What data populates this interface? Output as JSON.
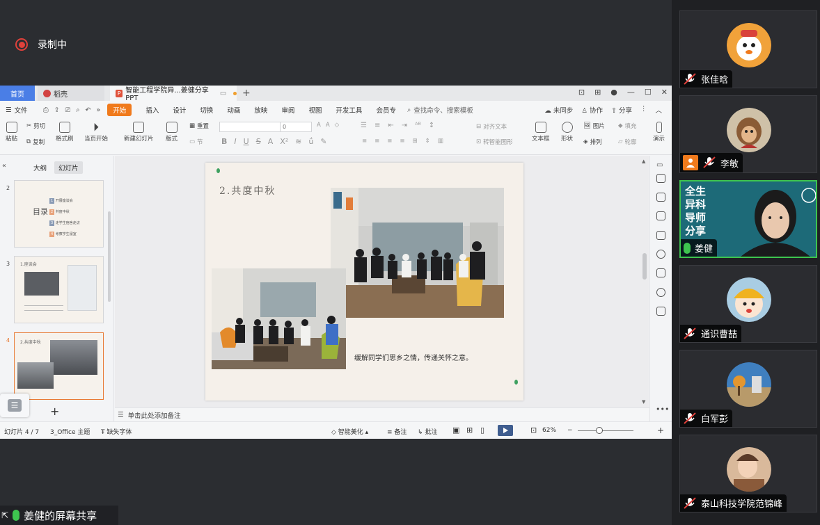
{
  "recording": {
    "label": "录制中"
  },
  "wps": {
    "tabs": {
      "home": "首页",
      "daoke": "稻壳",
      "doc": "智能工程学院异...姜健分享PPT"
    },
    "menu": {
      "file": "文件",
      "items": [
        "开始",
        "插入",
        "设计",
        "切换",
        "动画",
        "放映",
        "审阅",
        "视图",
        "开发工具",
        "会员专"
      ],
      "search": "查找命令、搜索模板",
      "unsynced": "未同步",
      "collab": "协作",
      "share": "分享"
    },
    "ribbon": {
      "paste": "粘贴",
      "cut": "剪切",
      "copy": "复制",
      "format_painter": "格式刷",
      "from_current": "当页开始",
      "new_slide": "新建幻灯片",
      "layout": "版式",
      "section": "节",
      "reset": "重置",
      "font_size": "0",
      "align_text": "对齐文本",
      "smart_shape": "转智能图形",
      "textbox": "文本框",
      "shape": "形状",
      "picture": "图片",
      "arrange": "排列",
      "fill": "填充",
      "outline": "轮廓",
      "present": "演示"
    },
    "left_panel": {
      "tab_outline": "大纲",
      "tab_slides": "幻灯片",
      "thumb2": {
        "num": "2",
        "title": "目录",
        "items": [
          "开展座谈会",
          "共度中秋",
          "走学生宿舍走访",
          "考察学生寝室"
        ]
      },
      "thumb3": {
        "num": "3",
        "title": "1.座谈会"
      },
      "thumb4": {
        "num": "4",
        "title": "2.共度中秋"
      }
    },
    "slide": {
      "title": "2.共度中秋",
      "caption": "缓解同学们思乡之情，传递关怀之意。"
    },
    "notes_placeholder": "单击此处添加备注",
    "status": {
      "slide_count": "幻灯片 4 / 7",
      "theme": "3_Office 主题",
      "missing_font": "缺失字体",
      "beautify": "智能美化",
      "notes": "备注",
      "comments": "批注",
      "zoom": "62%"
    }
  },
  "screen_share": {
    "label": "姜健的屏幕共享"
  },
  "participants": [
    {
      "name": "张佳晗",
      "muted": true
    },
    {
      "name": "李敏",
      "muted": true
    },
    {
      "name": "姜健",
      "muted": false,
      "active": true,
      "promo": [
        "全生",
        "异科",
        "导师",
        "分享"
      ]
    },
    {
      "name": "通识曹喆",
      "muted": true
    },
    {
      "name": "白军彭",
      "muted": true
    },
    {
      "name": "泰山科技学院范锦峰",
      "muted": true
    }
  ],
  "colors": {
    "accent_orange": "#f07a1c",
    "wps_blue": "#4a7ee6",
    "speaking_green": "#3ec44f",
    "record_red": "#e0413b"
  }
}
